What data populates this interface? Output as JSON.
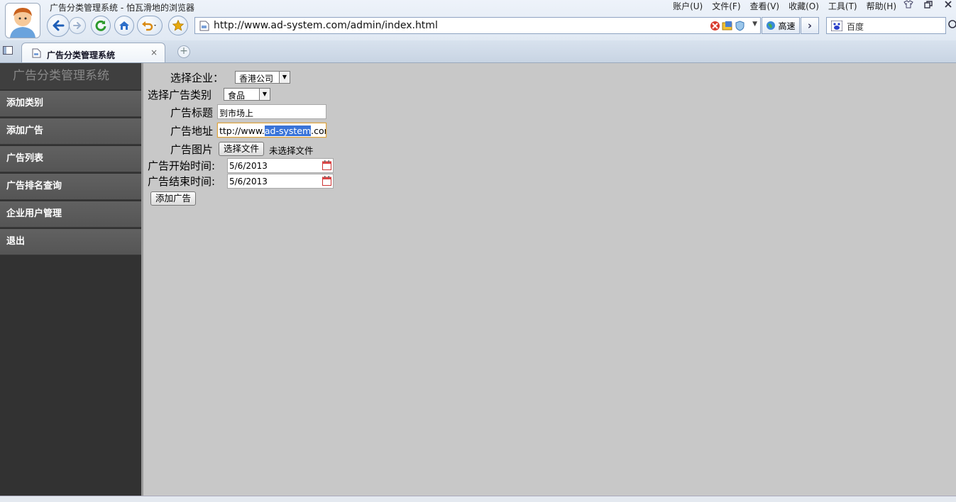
{
  "window": {
    "title": "广告分类管理系统 - 怕瓦滑地的浏览器",
    "menu": [
      "账户(U)",
      "文件(F)",
      "查看(V)",
      "收藏(O)",
      "工具(T)",
      "帮助(H)"
    ]
  },
  "toolbar": {
    "url": "http://www.ad-system.com/admin/index.html",
    "speed_label": "高速",
    "search_engine": "百度"
  },
  "tab": {
    "label": "广告分类管理系统",
    "close": "×",
    "new": "+"
  },
  "sidebar": {
    "title": "广告分类管理系统",
    "items": [
      "添加类别",
      "添加广告",
      "广告列表",
      "广告排名查询",
      "企业用户管理",
      "退出"
    ]
  },
  "form": {
    "company_label": "选择企业：",
    "company_value": "香港公司",
    "category_label": "选择广告类别",
    "category_value": "食品",
    "title_label": "广告标题",
    "title_value": "到市场上",
    "url_label": "广告地址",
    "url_prefix": "ttp://www.",
    "url_selected": "ad-system",
    "url_suffix": ".com",
    "image_label": "广告图片",
    "file_button": "选择文件",
    "file_status": "未选择文件",
    "start_label": "广告开始时间:",
    "start_value": "5/6/2013",
    "end_label": "广告结束时间:",
    "end_value": "5/6/2013",
    "submit_label": "添加广告"
  },
  "colors": {
    "sidebar_bg": "#323232",
    "nav_item_bg": "#5c5c5c",
    "content_bg": "#c8c8c8",
    "selection": "#3a74d8"
  }
}
